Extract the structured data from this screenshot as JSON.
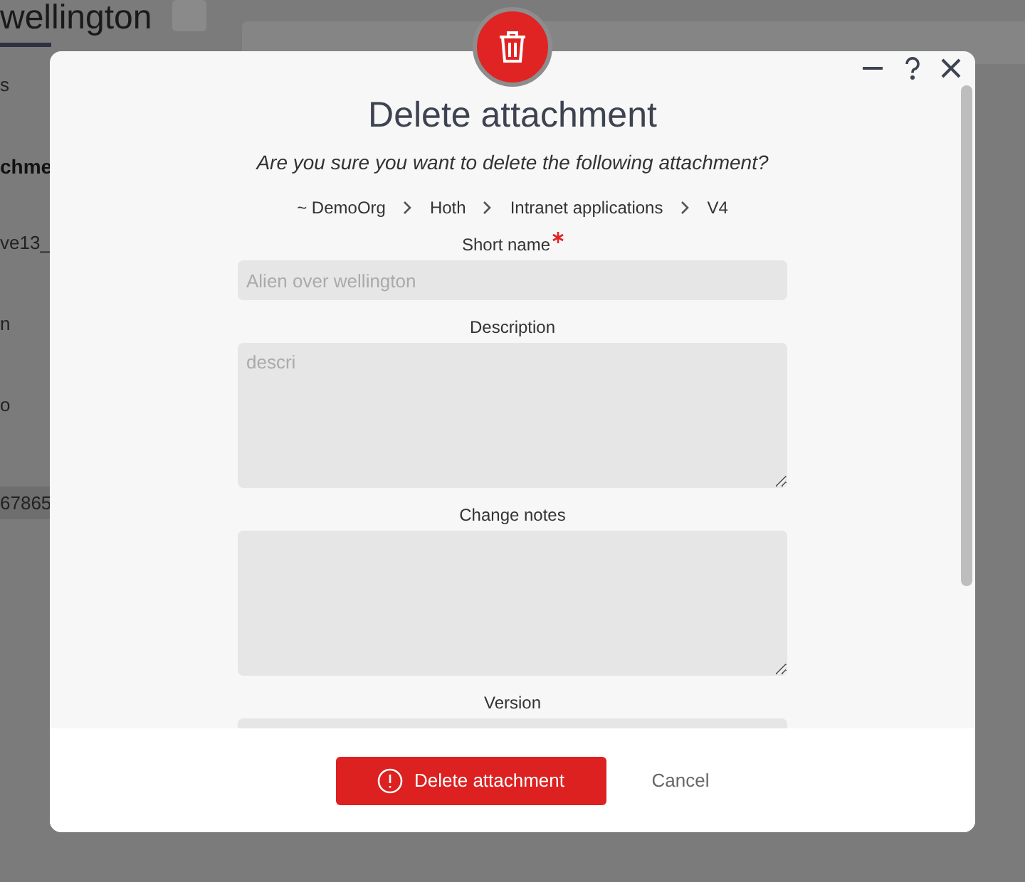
{
  "background": {
    "title": "wellington",
    "tab": "s",
    "section_heading": "chme",
    "rows": [
      {
        "text": "ve13_",
        "selected": false
      },
      {
        "text": "n",
        "selected": false
      },
      {
        "text": "o",
        "selected": false
      },
      {
        "text": "67865",
        "selected": true
      }
    ]
  },
  "dialog": {
    "title": "Delete attachment",
    "message": "Are you sure you want to delete the following attachment?",
    "breadcrumb": [
      "~ DemoOrg",
      "Hoth",
      "Intranet applications",
      "V4"
    ],
    "fields": [
      {
        "label": "Short name",
        "required": true,
        "kind": "input",
        "value": "Alien over wellington"
      },
      {
        "label": "Description",
        "required": false,
        "kind": "textarea",
        "value": "descri"
      },
      {
        "label": "Change notes",
        "required": false,
        "kind": "textarea"
      },
      {
        "label": "Version",
        "required": false,
        "kind": "input"
      }
    ],
    "buttons": {
      "confirm": "Delete attachment",
      "cancel": "Cancel"
    }
  }
}
